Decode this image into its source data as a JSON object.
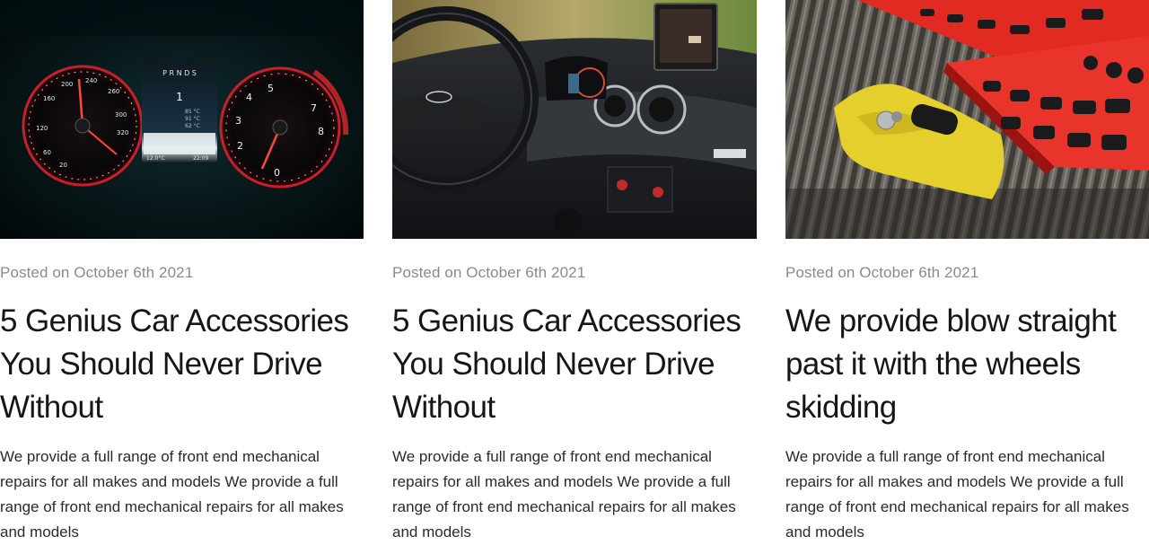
{
  "posts": [
    {
      "image": "car dashboard instrument cluster with red-lit speedometer and tachometer",
      "date": "Posted on October 6th 2021",
      "title": "5 Genius Car Accessories You Should Never Drive Without",
      "excerpt": "We provide a full range of front end mechanical repairs for all makes and models We provide a full range of front end mechanical repairs for all makes and models"
    },
    {
      "image": "car interior with steering wheel, air vents and infotainment screen",
      "date": "Posted on October 6th 2021",
      "title": "5 Genius Car Accessories You Should Never Drive Without",
      "excerpt": "We provide a full range of front end mechanical repairs for all makes and models We provide a full range of front end mechanical repairs for all makes and models"
    },
    {
      "image": "red socket tool set with yellow microfiber cloth on a wooden truck bed",
      "date": "Posted on October 6th 2021",
      "title": "We provide blow straight past it with the wheels skidding",
      "excerpt": "We provide a full range of front end mechanical repairs for all makes and models We provide a full range of front end mechanical repairs for all makes and models"
    }
  ],
  "dashboard": {
    "gear": "P R N D S",
    "left_dial": [
      "20",
      "40",
      "60",
      "80",
      "100",
      "120",
      "140",
      "160",
      "180",
      "200",
      "220",
      "240",
      "260",
      "280",
      "300",
      "320",
      "340"
    ],
    "right_dial": [
      "0",
      "1",
      "2",
      "3",
      "4",
      "5",
      "6",
      "7",
      "8"
    ],
    "temp": "12.0°C",
    "clock": "22:09",
    "center_gear": "1",
    "readings": [
      "85 °C",
      "91 °C",
      "62 °C"
    ]
  }
}
